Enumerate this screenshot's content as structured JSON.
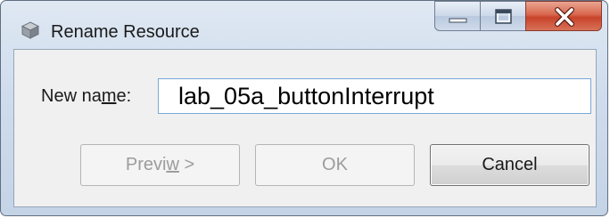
{
  "window": {
    "title": "Rename Resource",
    "app_icon": "eclipse-cube-icon",
    "caption_buttons": [
      "minimize-icon",
      "maximize-icon",
      "close-icon"
    ]
  },
  "form": {
    "label_before": "New na",
    "label_accel": "m",
    "label_after": "e:",
    "name_value": "lab_05a_buttonInterrupt"
  },
  "buttons": {
    "preview_before": "Previ",
    "preview_accel": "w",
    "preview_after": " >",
    "ok": "OK",
    "cancel": "Cancel"
  },
  "colors": {
    "close_button": "#c8432a",
    "input_border": "#7aa7d8",
    "disabled_text": "#9c9c9c"
  }
}
